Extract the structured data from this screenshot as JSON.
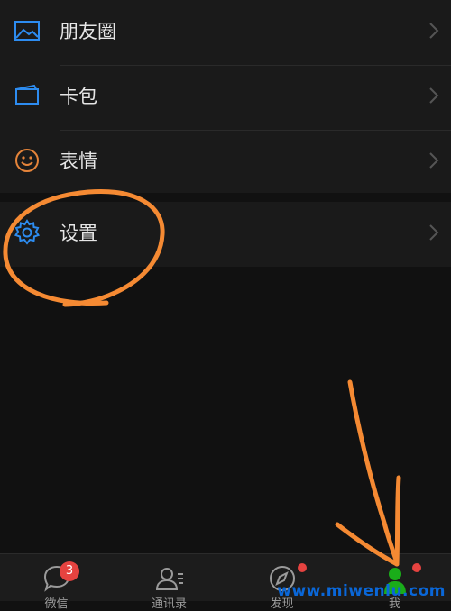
{
  "menu": {
    "items": [
      {
        "label": "朋友圈",
        "icon": "moments-icon",
        "icon_color": "#2d8cf0"
      },
      {
        "label": "卡包",
        "icon": "card-wallet-icon",
        "icon_color": "#2d8cf0"
      },
      {
        "label": "表情",
        "icon": "smiley-icon",
        "icon_color": "#e5843a"
      },
      {
        "label": "设置",
        "icon": "gear-icon",
        "icon_color": "#2d8cf0"
      }
    ]
  },
  "tabbar": {
    "tabs": [
      {
        "label": "微信",
        "icon": "chat-bubble-icon",
        "badge": "3"
      },
      {
        "label": "通讯录",
        "icon": "contacts-icon"
      },
      {
        "label": "发现",
        "icon": "compass-icon",
        "dot": true
      },
      {
        "label": "我",
        "icon": "person-icon",
        "active": true,
        "active_color": "#1aad19",
        "dot": true
      }
    ]
  },
  "watermark": "www.miwenlu.com",
  "colors": {
    "annotation": "#f58a33",
    "badge": "#e64340"
  }
}
